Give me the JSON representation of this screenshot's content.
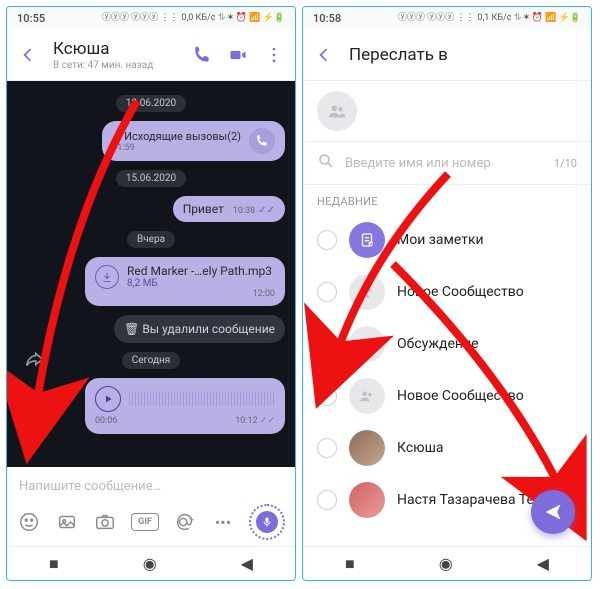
{
  "left": {
    "status": {
      "time": "10:55",
      "net": "0,0 КБ/с"
    },
    "header": {
      "title": "Ксюша",
      "subtitle": "В сети: 47 мин. назад"
    },
    "dates": {
      "d1": "12.06.2020",
      "d2": "15.06.2020",
      "d3": "Вчера",
      "d4": "Сегодня"
    },
    "call": {
      "text": "Исходящие вызовы(2)",
      "time": "11:59"
    },
    "msg1": {
      "text": "Привет",
      "time": "10:38"
    },
    "file": {
      "name": "Red Marker -…ely Path.mp3",
      "size": "8,2 МБ",
      "time": "12:00"
    },
    "deleted": {
      "text": "Вы удалили сообщение"
    },
    "voice": {
      "dur": "00:06",
      "time": "10:12"
    },
    "composer": {
      "placeholder": "Напишите сообщение…",
      "gif": "GIF"
    }
  },
  "right": {
    "status": {
      "time": "10:58",
      "net": "0,1 КБ/с"
    },
    "header": {
      "title": "Переслать в"
    },
    "search": {
      "placeholder": "Введите имя или номер",
      "count": "1/10"
    },
    "section": "НЕДАВНИЕ",
    "items": [
      {
        "label": "Мои заметки"
      },
      {
        "label": "Новое Сообщество"
      },
      {
        "label": "Обсуждение"
      },
      {
        "label": "Новое Сообщество"
      },
      {
        "label": "Ксюша"
      },
      {
        "label": "Настя Тазарачева Теле2"
      }
    ]
  }
}
